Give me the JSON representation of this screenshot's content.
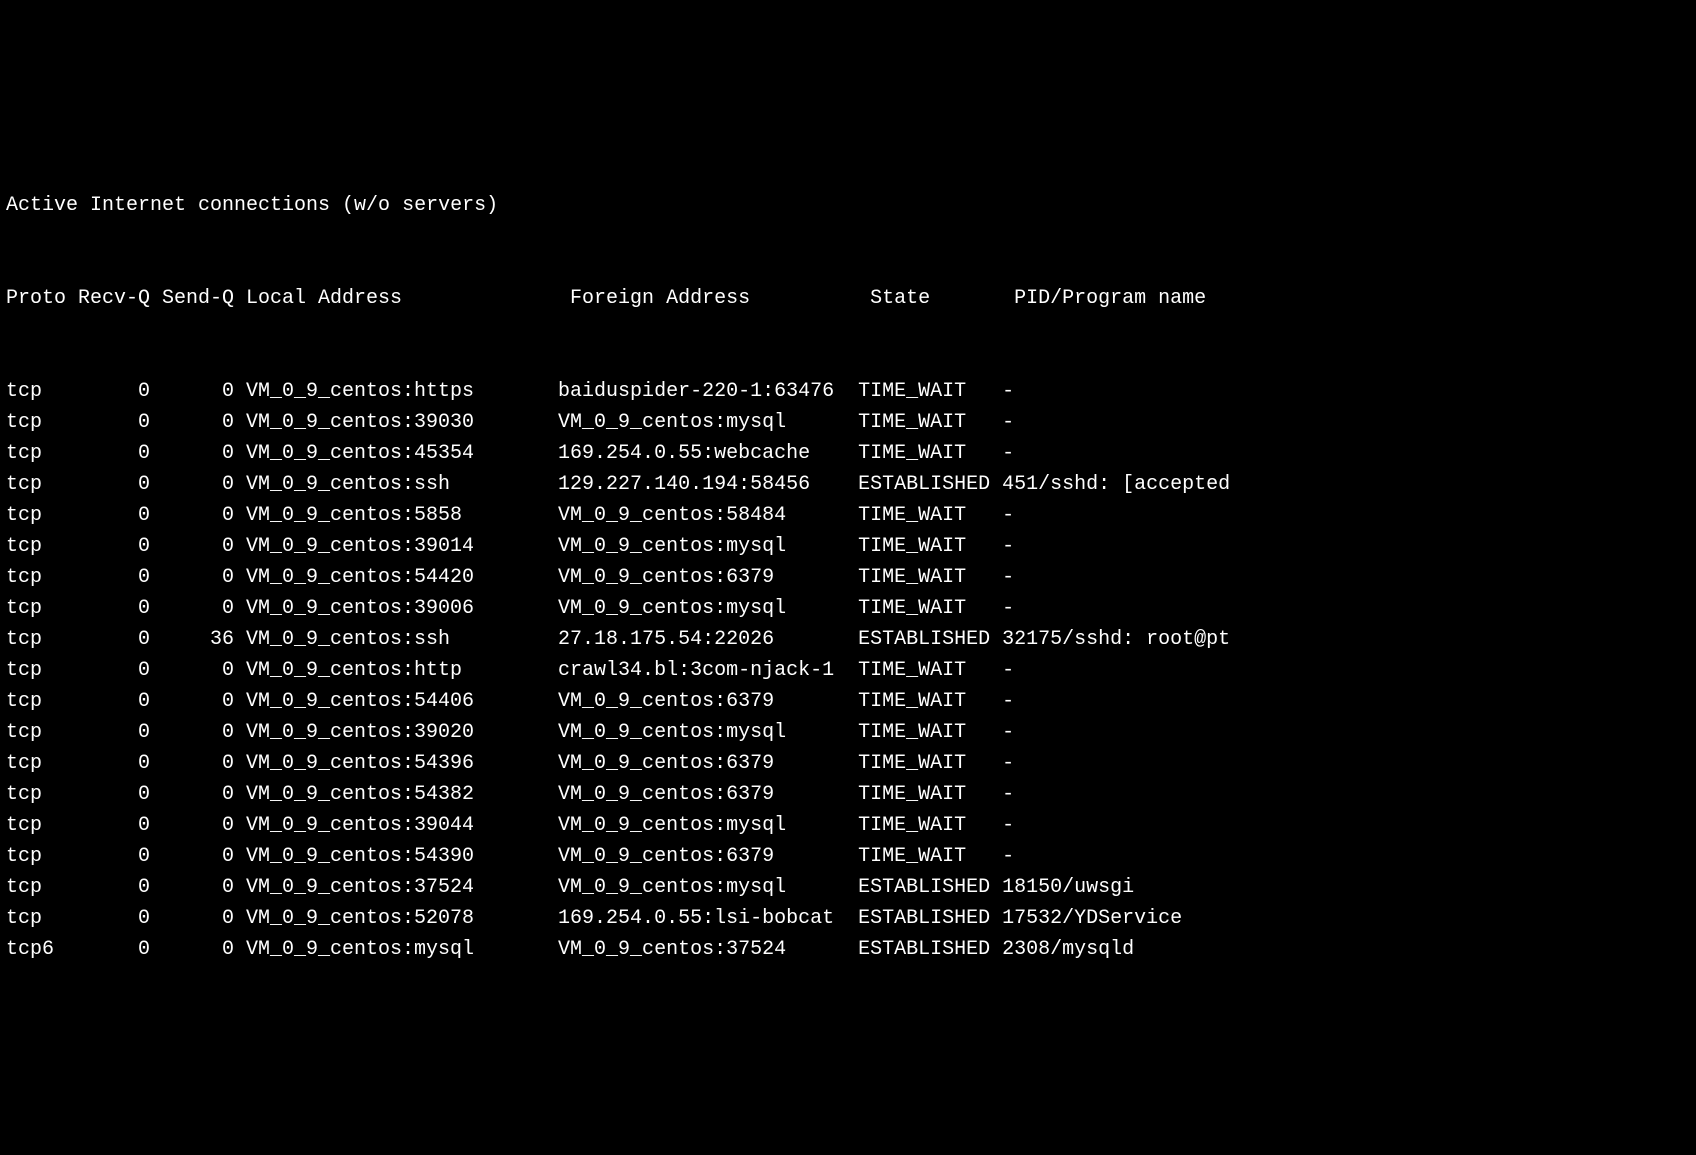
{
  "title": "Active Internet connections (w/o servers)",
  "headers": {
    "proto": "Proto",
    "recvq": "Recv-Q",
    "sendq": "Send-Q",
    "local": "Local Address",
    "foreign": "Foreign Address",
    "state": "State",
    "program": "PID/Program name"
  },
  "rows": [
    {
      "proto": "tcp",
      "recvq": "0",
      "sendq": "0",
      "local": "VM_0_9_centos:https",
      "foreign": "baiduspider-220-1:63476",
      "state": "TIME_WAIT",
      "program": "-"
    },
    {
      "proto": "tcp",
      "recvq": "0",
      "sendq": "0",
      "local": "VM_0_9_centos:39030",
      "foreign": "VM_0_9_centos:mysql",
      "state": "TIME_WAIT",
      "program": "-"
    },
    {
      "proto": "tcp",
      "recvq": "0",
      "sendq": "0",
      "local": "VM_0_9_centos:45354",
      "foreign": "169.254.0.55:webcache",
      "state": "TIME_WAIT",
      "program": "-"
    },
    {
      "proto": "tcp",
      "recvq": "0",
      "sendq": "0",
      "local": "VM_0_9_centos:ssh",
      "foreign": "129.227.140.194:58456",
      "state": "ESTABLISHED",
      "program": "451/sshd: [accepted"
    },
    {
      "proto": "tcp",
      "recvq": "0",
      "sendq": "0",
      "local": "VM_0_9_centos:5858",
      "foreign": "VM_0_9_centos:58484",
      "state": "TIME_WAIT",
      "program": "-"
    },
    {
      "proto": "tcp",
      "recvq": "0",
      "sendq": "0",
      "local": "VM_0_9_centos:39014",
      "foreign": "VM_0_9_centos:mysql",
      "state": "TIME_WAIT",
      "program": "-"
    },
    {
      "proto": "tcp",
      "recvq": "0",
      "sendq": "0",
      "local": "VM_0_9_centos:54420",
      "foreign": "VM_0_9_centos:6379",
      "state": "TIME_WAIT",
      "program": "-"
    },
    {
      "proto": "tcp",
      "recvq": "0",
      "sendq": "0",
      "local": "VM_0_9_centos:39006",
      "foreign": "VM_0_9_centos:mysql",
      "state": "TIME_WAIT",
      "program": "-"
    },
    {
      "proto": "tcp",
      "recvq": "0",
      "sendq": "36",
      "local": "VM_0_9_centos:ssh",
      "foreign": "27.18.175.54:22026",
      "state": "ESTABLISHED",
      "program": "32175/sshd: root@pt"
    },
    {
      "proto": "tcp",
      "recvq": "0",
      "sendq": "0",
      "local": "VM_0_9_centos:http",
      "foreign": "crawl34.bl:3com-njack-1",
      "state": "TIME_WAIT",
      "program": "-"
    },
    {
      "proto": "tcp",
      "recvq": "0",
      "sendq": "0",
      "local": "VM_0_9_centos:54406",
      "foreign": "VM_0_9_centos:6379",
      "state": "TIME_WAIT",
      "program": "-"
    },
    {
      "proto": "tcp",
      "recvq": "0",
      "sendq": "0",
      "local": "VM_0_9_centos:39020",
      "foreign": "VM_0_9_centos:mysql",
      "state": "TIME_WAIT",
      "program": "-"
    },
    {
      "proto": "tcp",
      "recvq": "0",
      "sendq": "0",
      "local": "VM_0_9_centos:54396",
      "foreign": "VM_0_9_centos:6379",
      "state": "TIME_WAIT",
      "program": "-"
    },
    {
      "proto": "tcp",
      "recvq": "0",
      "sendq": "0",
      "local": "VM_0_9_centos:54382",
      "foreign": "VM_0_9_centos:6379",
      "state": "TIME_WAIT",
      "program": "-"
    },
    {
      "proto": "tcp",
      "recvq": "0",
      "sendq": "0",
      "local": "VM_0_9_centos:39044",
      "foreign": "VM_0_9_centos:mysql",
      "state": "TIME_WAIT",
      "program": "-"
    },
    {
      "proto": "tcp",
      "recvq": "0",
      "sendq": "0",
      "local": "VM_0_9_centos:54390",
      "foreign": "VM_0_9_centos:6379",
      "state": "TIME_WAIT",
      "program": "-"
    },
    {
      "proto": "tcp",
      "recvq": "0",
      "sendq": "0",
      "local": "VM_0_9_centos:37524",
      "foreign": "VM_0_9_centos:mysql",
      "state": "ESTABLISHED",
      "program": "18150/uwsgi"
    },
    {
      "proto": "tcp",
      "recvq": "0",
      "sendq": "0",
      "local": "VM_0_9_centos:52078",
      "foreign": "169.254.0.55:lsi-bobcat",
      "state": "ESTABLISHED",
      "program": "17532/YDService"
    },
    {
      "proto": "tcp6",
      "recvq": "0",
      "sendq": "0",
      "local": "VM_0_9_centos:mysql",
      "foreign": "VM_0_9_centos:37524",
      "state": "ESTABLISHED",
      "program": "2308/mysqld"
    }
  ]
}
